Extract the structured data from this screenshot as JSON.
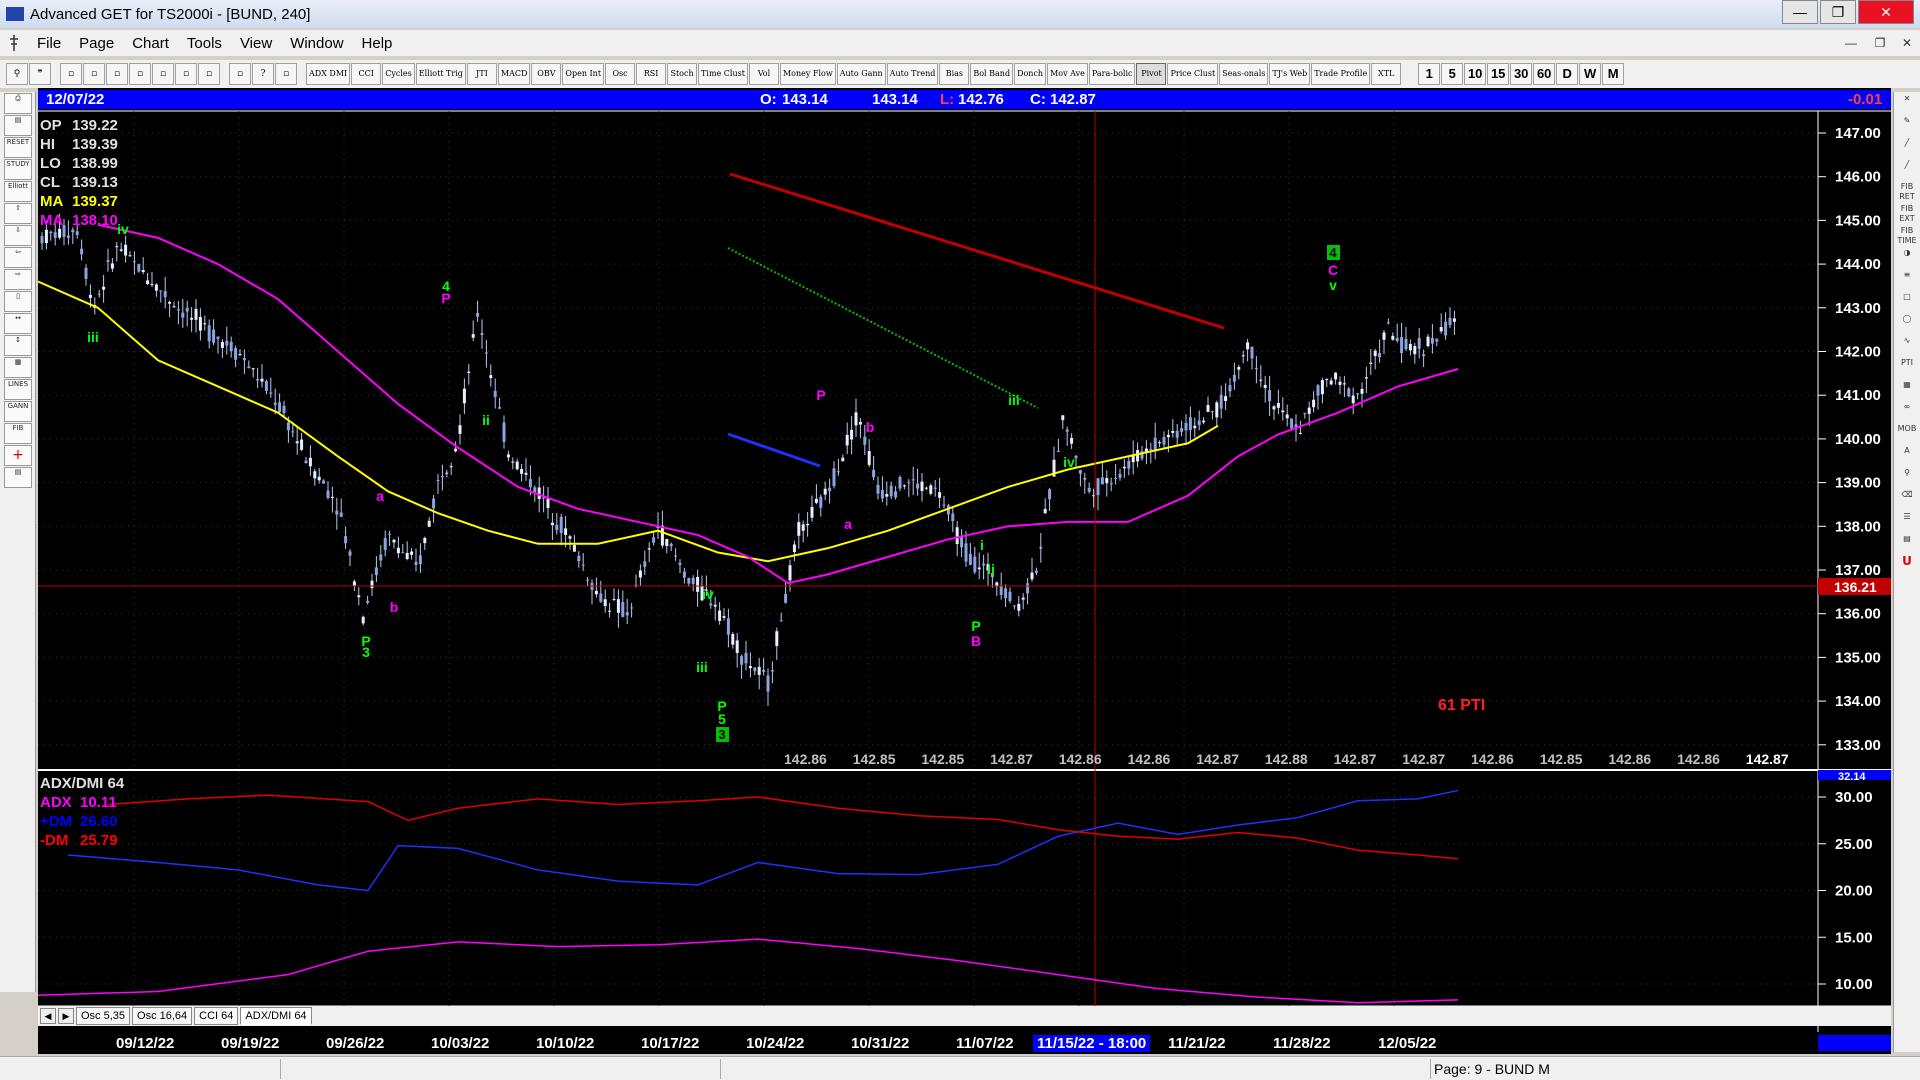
{
  "window": {
    "title": "Advanced GET for TS2000i - [BUND, 240]"
  },
  "menu": [
    "File",
    "Page",
    "Chart",
    "Tools",
    "View",
    "Window",
    "Help"
  ],
  "toolbar": {
    "studies": [
      "ADX DMI",
      "CCI",
      "Cycles",
      "Elliott Trig",
      "JTI",
      "MACD",
      "OBV",
      "Open Int",
      "Osc",
      "RSI",
      "Stoch",
      "Time Clust",
      "Vol",
      "Money Flow",
      "Auto Gann",
      "Auto Trend",
      "Bias",
      "Bol Band",
      "Donch",
      "Mov Ave",
      "Para-bolic",
      "Pivot",
      "Price Clust",
      "Seas-onals",
      "TJ's Web",
      "Trade Profile",
      "XTL"
    ],
    "intervals": [
      "1",
      "5",
      "10",
      "15",
      "30",
      "60",
      "D",
      "W",
      "M"
    ]
  },
  "header": {
    "date": "12/07/22",
    "o_label": "O:",
    "o_value": "143.14",
    "h_value": "143.14",
    "l_label": "L:",
    "l_value": "142.76",
    "c_label": "C:",
    "c_value": "142.87",
    "change": "-0.01"
  },
  "price_info": [
    {
      "label": "OP",
      "value": "139.22",
      "color": "#e0e0e0"
    },
    {
      "label": "HI",
      "value": "139.39",
      "color": "#e0e0e0"
    },
    {
      "label": "LO",
      "value": "138.99",
      "color": "#e0e0e0"
    },
    {
      "label": "CL",
      "value": "139.13",
      "color": "#e0e0e0"
    },
    {
      "label": "MA",
      "value": "139.37",
      "color": "#ffff00"
    },
    {
      "label": "MA",
      "value": "138.10",
      "color": "#ff00ff"
    }
  ],
  "price_axis": [
    "147.00",
    "146.00",
    "145.00",
    "144.00",
    "143.00",
    "142.00",
    "141.00",
    "140.00",
    "139.00",
    "138.00",
    "137.00",
    "136.00",
    "135.00",
    "134.00",
    "133.00"
  ],
  "crosshair_price": "136.21",
  "pti_label": "61 PTI",
  "cursor_values": [
    "142.86",
    "142.85",
    "142.85",
    "142.87",
    "142.86",
    "142.86",
    "142.87",
    "142.88",
    "142.87",
    "142.87",
    "142.86",
    "142.85",
    "142.86",
    "142.86",
    "142.87"
  ],
  "wave_labels": [
    {
      "text": "iv",
      "color": "#00ff00"
    },
    {
      "text": "iii",
      "color": "#00ff00"
    },
    {
      "text": "4",
      "color": "#00ff00"
    },
    {
      "text": "P",
      "color": "#ff00ff"
    },
    {
      "text": "ii",
      "color": "#00ff00"
    },
    {
      "text": "a",
      "color": "#ff00ff"
    },
    {
      "text": "b",
      "color": "#ff00ff"
    },
    {
      "text": "P",
      "color": "#00ff00"
    },
    {
      "text": "3",
      "color": "#00ff00"
    },
    {
      "text": "iv",
      "color": "#00ff00"
    },
    {
      "text": "iii",
      "color": "#00ff00"
    },
    {
      "text": "P",
      "color": "#00ff00"
    },
    {
      "text": "5",
      "color": "#00ff00"
    },
    {
      "text": "3",
      "color": "#00ff00"
    },
    {
      "text": "P",
      "color": "#ff00ff"
    },
    {
      "text": "b",
      "color": "#ff00ff"
    },
    {
      "text": "a",
      "color": "#ff00ff"
    },
    {
      "text": "i",
      "color": "#00ff00"
    },
    {
      "text": "ii",
      "color": "#00ff00"
    },
    {
      "text": "P",
      "color": "#00ff00"
    },
    {
      "text": "B",
      "color": "#ff00ff"
    },
    {
      "text": "iii",
      "color": "#00ff00"
    },
    {
      "text": "iv",
      "color": "#00ff00"
    },
    {
      "text": "4",
      "color": "#00ff00"
    },
    {
      "text": "C",
      "color": "#ff00ff"
    },
    {
      "text": "v",
      "color": "#00ff00"
    }
  ],
  "indicator": {
    "title": "ADX/DMI 64",
    "lines": [
      {
        "label": "ADX",
        "value": "10.11",
        "color": "#ff00ff"
      },
      {
        "label": "+DM",
        "value": "26.60",
        "color": "#0000ff"
      },
      {
        "label": "-DM",
        "value": "25.79",
        "color": "#ff0000"
      }
    ],
    "axis": [
      "30.00",
      "25.00",
      "20.00",
      "15.00",
      "10.00"
    ],
    "top_value": "32.14"
  },
  "tabs": [
    "Osc 5,35",
    "Osc 16,64",
    "CCI 64",
    "ADX/DMI 64"
  ],
  "time_axis": [
    "09/12/22",
    "09/19/22",
    "09/26/22",
    "10/03/22",
    "10/10/22",
    "10/17/22",
    "10/24/22",
    "10/31/22",
    "11/07/22",
    "11/15/22 - 18:00",
    "11/21/22",
    "11/28/22",
    "12/05/22"
  ],
  "status": {
    "page": "Page: 9 - BUND M"
  },
  "colors": {
    "chart_bg": "#000000",
    "header_bg": "#0000ff",
    "candle": "#c8d8ff",
    "ma_fast": "#ffff00",
    "ma_slow": "#ff00ff",
    "crosshair": "#c00000"
  }
}
